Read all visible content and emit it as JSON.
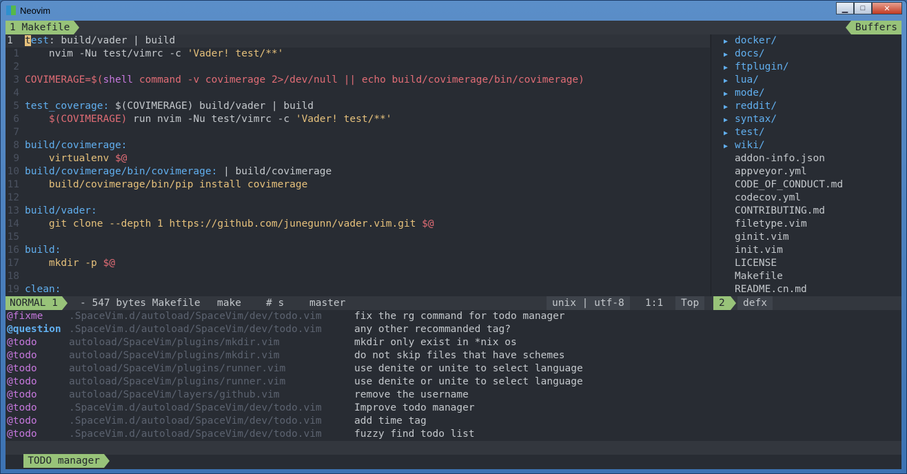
{
  "window": {
    "title": "Neovim",
    "buttons": [
      "minimize",
      "maximize",
      "close"
    ]
  },
  "tabline": {
    "left": "1 Makefile",
    "right": "Buffers"
  },
  "editor": {
    "cursor_line_number": "1",
    "lines": [
      {
        "n": "",
        "seg": [
          [
            "t",
            "cursor"
          ],
          [
            "est",
            "t"
          ],
          [
            ": build/vader | build",
            "g"
          ]
        ]
      },
      {
        "n": "1",
        "seg": [
          [
            "    nvim -Nu test/vimrc -c ",
            "g"
          ],
          [
            "'Vader! test/**'",
            "s"
          ]
        ]
      },
      {
        "n": "2",
        "seg": []
      },
      {
        "n": "3",
        "seg": [
          [
            "COVIMERAGE=$(",
            "r"
          ],
          [
            "shell",
            "p"
          ],
          [
            " command -v covimerage 2>/dev/null || echo build/covimerage/bin/covimerage)",
            "r"
          ]
        ]
      },
      {
        "n": "4",
        "seg": []
      },
      {
        "n": "5",
        "seg": [
          [
            "test_coverage:",
            "t"
          ],
          [
            " $(COVIMERAGE) build/vader | build",
            "g"
          ]
        ]
      },
      {
        "n": "6",
        "seg": [
          [
            "    $(COVIMERAGE)",
            "r"
          ],
          [
            " run nvim -Nu test/vimrc -c ",
            "g"
          ],
          [
            "'Vader! test/**'",
            "s"
          ]
        ]
      },
      {
        "n": "7",
        "seg": []
      },
      {
        "n": "8",
        "seg": [
          [
            "build/covimerage:",
            "t"
          ]
        ]
      },
      {
        "n": "9",
        "seg": [
          [
            "    virtualenv ",
            "s"
          ],
          [
            "$@",
            "r"
          ]
        ]
      },
      {
        "n": "10",
        "seg": [
          [
            "build/covimerage/bin/covimerage:",
            "t"
          ],
          [
            " | build/covimerage",
            "g"
          ]
        ]
      },
      {
        "n": "11",
        "seg": [
          [
            "    build/covimerage/bin/pip install covimerage",
            "s"
          ]
        ]
      },
      {
        "n": "12",
        "seg": []
      },
      {
        "n": "13",
        "seg": [
          [
            "build/vader:",
            "t"
          ]
        ]
      },
      {
        "n": "14",
        "seg": [
          [
            "    git clone --depth 1 https://github.com/junegunn/vader.vim.git ",
            "s"
          ],
          [
            "$@",
            "r"
          ]
        ]
      },
      {
        "n": "15",
        "seg": []
      },
      {
        "n": "16",
        "seg": [
          [
            "build:",
            "t"
          ]
        ]
      },
      {
        "n": "17",
        "seg": [
          [
            "    mkdir -p ",
            "s"
          ],
          [
            "$@",
            "r"
          ]
        ]
      },
      {
        "n": "18",
        "seg": []
      },
      {
        "n": "19",
        "seg": [
          [
            "clean:",
            "t"
          ]
        ]
      }
    ]
  },
  "filetree": {
    "items": [
      {
        "name": "docker/",
        "dir": true
      },
      {
        "name": "docs/",
        "dir": true
      },
      {
        "name": "ftplugin/",
        "dir": true
      },
      {
        "name": "lua/",
        "dir": true
      },
      {
        "name": "mode/",
        "dir": true
      },
      {
        "name": "reddit/",
        "dir": true
      },
      {
        "name": "syntax/",
        "dir": true
      },
      {
        "name": "test/",
        "dir": true
      },
      {
        "name": "wiki/",
        "dir": true
      },
      {
        "name": "addon-info.json",
        "dir": false
      },
      {
        "name": "appveyor.yml",
        "dir": false
      },
      {
        "name": "CODE_OF_CONDUCT.md",
        "dir": false
      },
      {
        "name": "codecov.yml",
        "dir": false
      },
      {
        "name": "CONTRIBUTING.md",
        "dir": false
      },
      {
        "name": "filetype.vim",
        "dir": false
      },
      {
        "name": "ginit.vim",
        "dir": false
      },
      {
        "name": "init.vim",
        "dir": false
      },
      {
        "name": "LICENSE",
        "dir": false
      },
      {
        "name": "Makefile",
        "dir": false
      },
      {
        "name": "README.cn.md",
        "dir": false
      }
    ]
  },
  "statusline": {
    "mode": "NORMAL 1",
    "file": "- 547 bytes Makefile",
    "filetype": "make",
    "syntax": "# s",
    "branch": "master",
    "encoding": "unix | utf-8",
    "position": "1:1",
    "scroll": "Top",
    "side_num": "2",
    "side_name": "defx"
  },
  "todos": [
    {
      "tag": "@fixme",
      "path": ".SpaceVim.d/autoload/SpaceVim/dev/todo.vim",
      "text": "fix the rg command for todo manager"
    },
    {
      "tag": "@question",
      "path": ".SpaceVim.d/autoload/SpaceVim/dev/todo.vim",
      "text": "any other recommanded tag?"
    },
    {
      "tag": "@todo",
      "path": "autoload/SpaceVim/plugins/mkdir.vim",
      "text": "mkdir only exist in *nix os"
    },
    {
      "tag": "@todo",
      "path": "autoload/SpaceVim/plugins/mkdir.vim",
      "text": "do not skip files that have schemes"
    },
    {
      "tag": "@todo",
      "path": "autoload/SpaceVim/plugins/runner.vim",
      "text": "use denite or unite to select language"
    },
    {
      "tag": "@todo",
      "path": "autoload/SpaceVim/plugins/runner.vim",
      "text": "use denite or unite to select language"
    },
    {
      "tag": "@todo",
      "path": "autoload/SpaceVim/layers/github.vim",
      "text": "remove the username"
    },
    {
      "tag": "@todo",
      "path": ".SpaceVim.d/autoload/SpaceVim/dev/todo.vim",
      "text": "Improve todo manager"
    },
    {
      "tag": "@todo",
      "path": ".SpaceVim.d/autoload/SpaceVim/dev/todo.vim",
      "text": "add time tag"
    },
    {
      "tag": "@todo",
      "path": ".SpaceVim.d/autoload/SpaceVim/dev/todo.vim",
      "text": "fuzzy find todo list"
    }
  ],
  "bottom": {
    "label": "TODO manager"
  }
}
